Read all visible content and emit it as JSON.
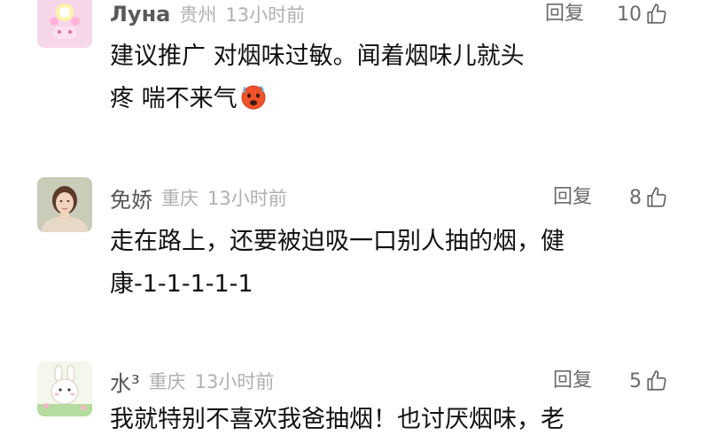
{
  "comments": [
    {
      "username": "Луна",
      "location": "贵州",
      "time": "13小时前",
      "reply_label": "回复",
      "likes": "10",
      "lines": [
        "建议推广 对烟味过敏。闻着烟味儿就头",
        "疼 喘不来气"
      ],
      "emoji": "hot-face-emoji"
    },
    {
      "username": "免娇",
      "location": "重庆",
      "time": "13小时前",
      "reply_label": "回复",
      "likes": "8",
      "lines": [
        "走在路上，还要被迫吸一口别人抽的烟，健",
        "康-1-1-1-1-1"
      ]
    },
    {
      "username": "水³",
      "location": "重庆",
      "time": "13小时前",
      "reply_label": "回复",
      "likes": "5",
      "lines": [
        "我就特别不喜欢我爸抽烟！也讨厌烟味，老"
      ]
    }
  ],
  "icons": {
    "like": "thumbs-up-icon"
  },
  "colors": {
    "username": "#5a5a5a",
    "meta": "#b0b0b0",
    "text": "#111111"
  }
}
